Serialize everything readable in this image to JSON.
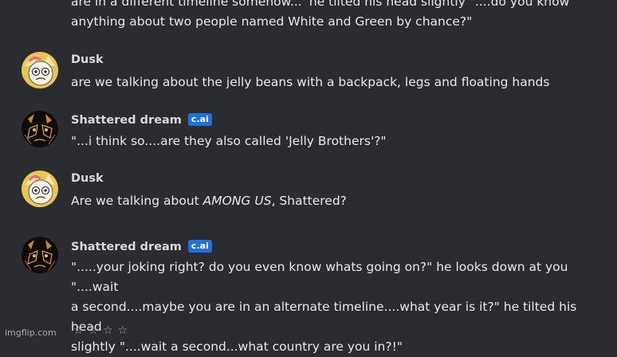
{
  "intro": {
    "line1": "are in a different timeline somehow...' he tilted his head slightly \"....do you know",
    "line2": "anything about two people named White and Green by chance?\""
  },
  "messages": [
    {
      "author": "Dusk",
      "text": "are we talking about the jelly beans with a backpack, legs and floating hands"
    },
    {
      "author": "Shattered dream",
      "badge": "c.ai",
      "text": "\"...i think so....are they also called 'Jelly Brothers'?\""
    },
    {
      "author": "Dusk",
      "text_pre": "Are we talking about ",
      "text_em": "AMONG US",
      "text_post": ", Shattered?"
    },
    {
      "author": "Shattered dream",
      "badge": "c.ai",
      "lines": [
        "\".....your joking right? do you even know whats going on?\" he looks down at you \"....wait",
        "a second....maybe you are in an alternate timeline....what year is it?\" he tilted his head",
        "slightly \"....wait a second...what country are you in?!\""
      ]
    }
  ],
  "footer": {
    "watermark": "imgflip.com",
    "stars": "☆☆☆☆"
  },
  "colors": {
    "background": "#2b2c2f",
    "badge": "#1f6fe5",
    "text": "#e8e8e8"
  }
}
